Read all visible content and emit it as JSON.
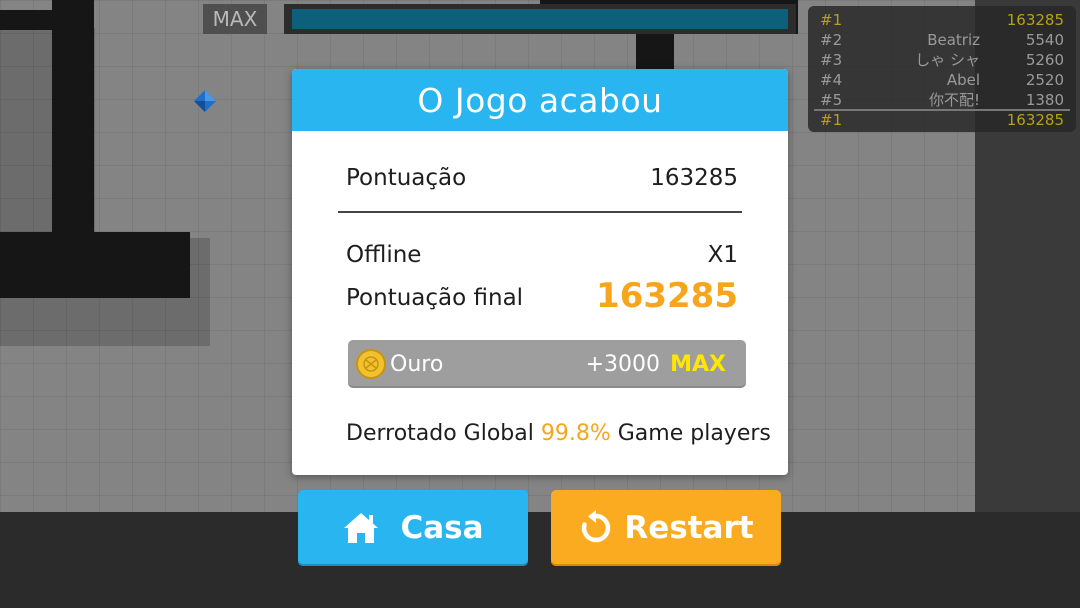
{
  "hud": {
    "max_label": "MAX",
    "progress": 1.0,
    "bar_color": "#0d5f7a"
  },
  "leaderboard": {
    "rows": [
      {
        "rank": "#1",
        "name": "",
        "score": "163285",
        "highlight": true
      },
      {
        "rank": "#2",
        "name": "Beatriz",
        "score": "5540",
        "highlight": false
      },
      {
        "rank": "#3",
        "name": "しゃ シャ",
        "score": "5260",
        "highlight": false
      },
      {
        "rank": "#4",
        "name": "Abel",
        "score": "2520",
        "highlight": false
      },
      {
        "rank": "#5",
        "name": "你不配!",
        "score": "1380",
        "highlight": false
      }
    ],
    "self": {
      "rank": "#1",
      "score": "163285"
    }
  },
  "dialog": {
    "title": "O Jogo acabou",
    "score_label": "Pontuação",
    "score_value": "163285",
    "offline_label": "Offline",
    "offline_value": "X1",
    "final_label": "Pontuação final",
    "final_value": "163285",
    "gold": {
      "label": "Ouro",
      "amount": "+3000",
      "max": "MAX",
      "icon": "coin-icon"
    },
    "defeat": {
      "prefix": "Derrotado Global",
      "percent": "99.8%",
      "suffix": "Game players"
    }
  },
  "buttons": {
    "home_label": "Casa",
    "home_icon": "home-icon",
    "restart_label": "Restart",
    "restart_icon": "restart-icon"
  },
  "colors": {
    "accent_blue": "#29b6f0",
    "accent_orange": "#fbab1f",
    "score_orange": "#f7a51d",
    "gem_blue": "#1e6fc9"
  }
}
